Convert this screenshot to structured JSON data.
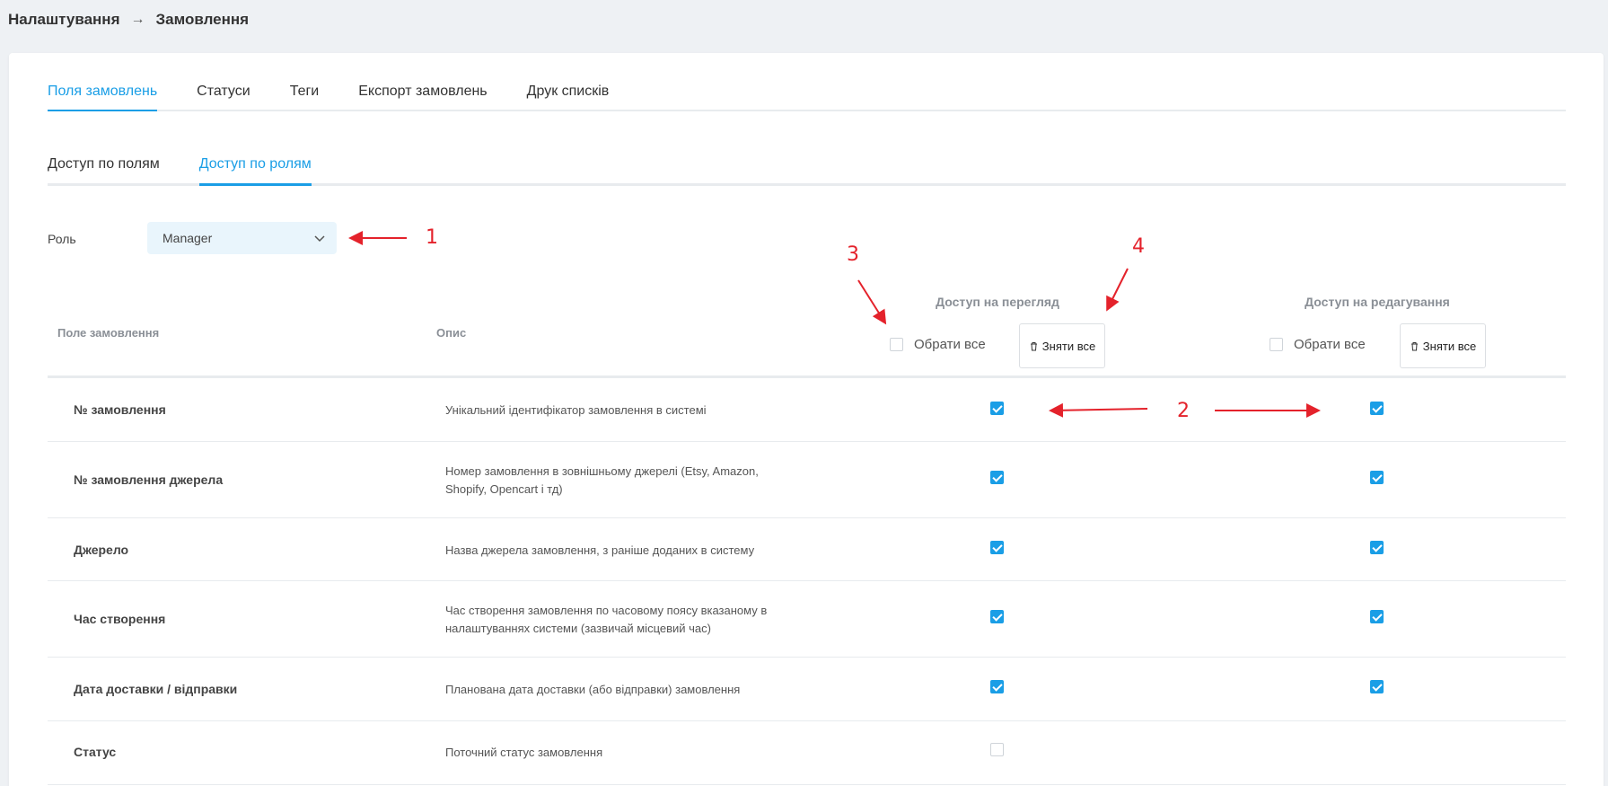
{
  "breadcrumb": {
    "root": "Налаштування",
    "separator": "→",
    "current": "Замовлення"
  },
  "main_tabs": [
    {
      "label": "Поля замовлень",
      "active": true
    },
    {
      "label": "Статуси",
      "active": false
    },
    {
      "label": "Теги",
      "active": false
    },
    {
      "label": "Експорт замовлень",
      "active": false
    },
    {
      "label": "Друк списків",
      "active": false
    }
  ],
  "sub_tabs": [
    {
      "label": "Доступ по полям",
      "active": false
    },
    {
      "label": "Доступ по ролям",
      "active": true
    }
  ],
  "role": {
    "label": "Роль",
    "value": "Manager"
  },
  "table": {
    "col_field": "Поле замовлення",
    "col_desc": "Опис",
    "view_group": {
      "title": "Доступ на перегляд",
      "select_all": "Обрати все",
      "clear_all": "Зняти все"
    },
    "edit_group": {
      "title": "Доступ на редагування",
      "select_all": "Обрати все",
      "clear_all": "Зняти все"
    },
    "rows": [
      {
        "name": "№ замовлення",
        "desc": "Унікальний ідентифікатор замовлення в системі",
        "view": true,
        "edit": true
      },
      {
        "name": "№ замовлення джерела",
        "desc": "Номер замовлення в зовнішньому джерелі (Etsy, Amazon, Shopify, Opencart і тд)",
        "view": true,
        "edit": true
      },
      {
        "name": "Джерело",
        "desc": "Назва джерела замовлення, з раніше доданих в систему",
        "view": true,
        "edit": true
      },
      {
        "name": "Час створення",
        "desc": "Час створення замовлення по часовому поясу вказаному в налаштуваннях системи (зазвичай місцевий час)",
        "view": true,
        "edit": true
      },
      {
        "name": "Дата доставки / відправки",
        "desc": "Планована дата доставки (або відправки) замовлення",
        "view": true,
        "edit": true
      },
      {
        "name": "Статус",
        "desc": "Поточний статус замовлення",
        "view": false,
        "edit": null
      }
    ]
  },
  "annotations": [
    "1",
    "2",
    "3",
    "4"
  ],
  "colors": {
    "accent": "#1a9ee6",
    "annotation": "#e4222b",
    "background": "#eef1f4"
  }
}
